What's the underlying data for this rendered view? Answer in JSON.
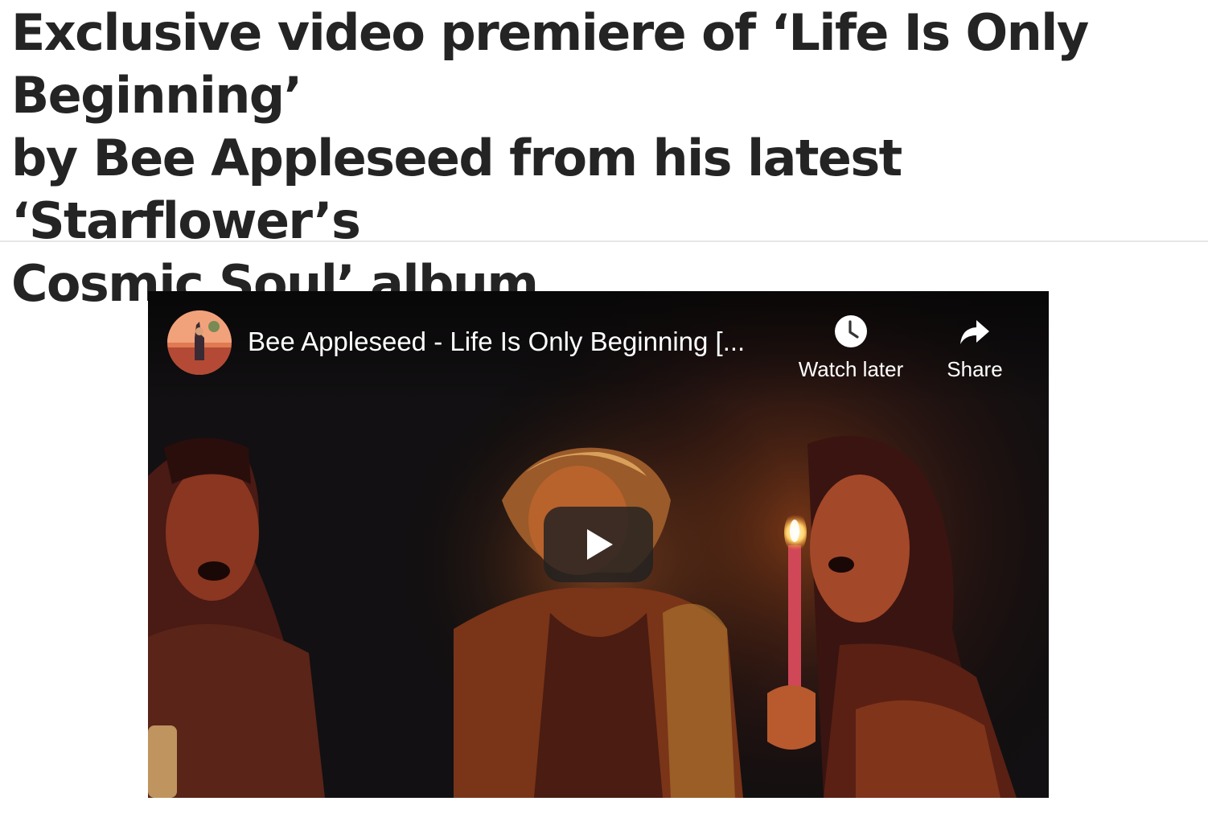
{
  "article": {
    "headline_lines": [
      "Exclusive video premiere of ‘Life Is Only Beginning’",
      "by Bee Appleseed from his latest ‘Starflower’s",
      "Cosmic Soul’ album."
    ]
  },
  "video": {
    "title": "Bee Appleseed - Life Is Only Beginning [...",
    "channel_avatar_icon": "channel-avatar",
    "watch_later_label": "Watch later",
    "watch_later_icon": "clock-icon",
    "share_label": "Share",
    "share_icon": "share-arrow-icon",
    "play_icon": "play-icon"
  }
}
